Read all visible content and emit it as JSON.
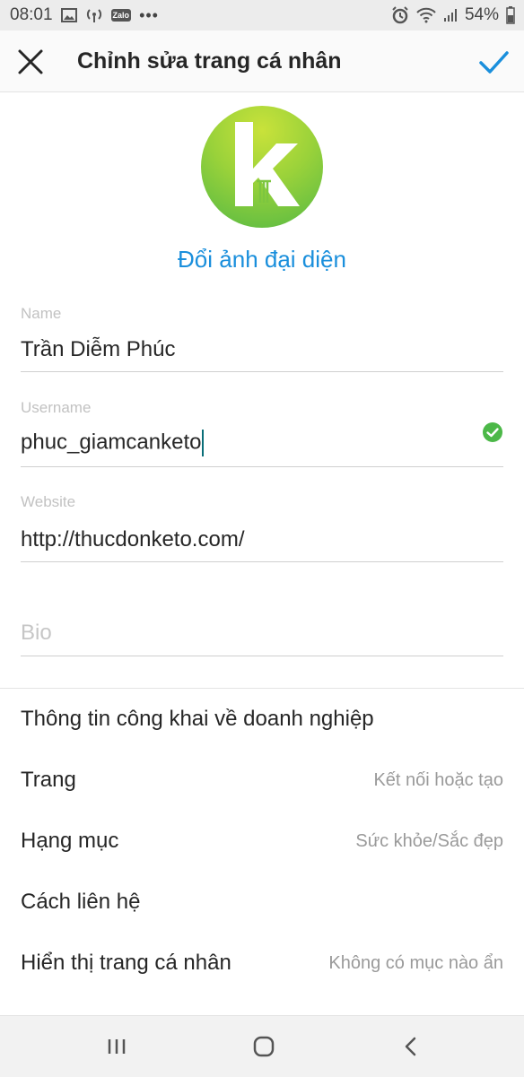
{
  "status_bar": {
    "time": "08:01",
    "battery": "54%",
    "zalo": "Zalo",
    "more": "•••"
  },
  "header": {
    "title": "Chỉnh sửa trang cá nhân"
  },
  "profile": {
    "change_photo_label": "Đổi ảnh đại diện"
  },
  "fields": {
    "name": {
      "label": "Name",
      "value": "Trần Diễm Phúc"
    },
    "username": {
      "label": "Username",
      "value": "phuc_giamcanketo"
    },
    "website": {
      "label": "Website",
      "value": "http://thucdonketo.com/"
    },
    "bio": {
      "placeholder": "Bio",
      "value": ""
    }
  },
  "business": {
    "section_title": "Thông tin công khai về doanh nghiệp",
    "rows": [
      {
        "label": "Trang",
        "value": "Kết nối hoặc tạo"
      },
      {
        "label": "Hạng mục",
        "value": "Sức khỏe/Sắc đẹp"
      },
      {
        "label": "Cách liên hệ",
        "value": ""
      },
      {
        "label": "Hiển thị trang cá nhân",
        "value": "Không có mục nào ẩn"
      }
    ]
  },
  "colors": {
    "accent_blue": "#1a8fdc",
    "check_green": "#4cb848",
    "avatar_green": "#7cc63f"
  }
}
